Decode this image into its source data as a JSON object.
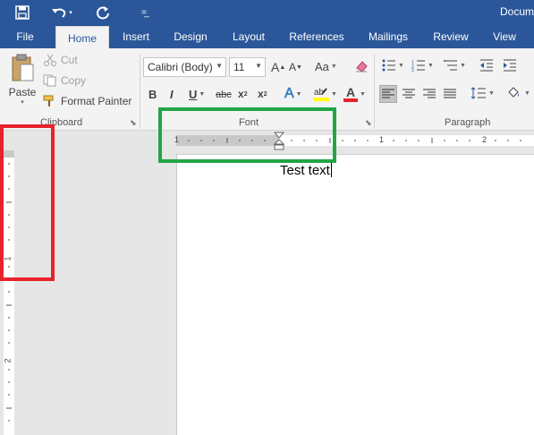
{
  "titlebar": {
    "doc_title": "Docum",
    "icons": [
      "save-icon",
      "undo-icon",
      "redo-icon",
      "customize-qat-icon"
    ]
  },
  "tabs": [
    {
      "label": "File",
      "active": false
    },
    {
      "label": "Home",
      "active": true
    },
    {
      "label": "Insert",
      "active": false
    },
    {
      "label": "Design",
      "active": false
    },
    {
      "label": "Layout",
      "active": false
    },
    {
      "label": "References",
      "active": false
    },
    {
      "label": "Mailings",
      "active": false
    },
    {
      "label": "Review",
      "active": false
    },
    {
      "label": "View",
      "active": false
    }
  ],
  "clipboard": {
    "paste_label": "Paste",
    "cut_label": "Cut",
    "copy_label": "Copy",
    "format_painter_label": "Format Painter",
    "group_label": "Clipboard"
  },
  "font": {
    "font_name": "Calibri (Body)",
    "font_size": "11",
    "grow_label": "A",
    "shrink_label": "A",
    "change_case_label": "Aa",
    "bold": "B",
    "italic": "I",
    "underline": "U",
    "strikethrough": "abc",
    "subscript": "x",
    "superscript": "x",
    "text_effects": "A",
    "font_color": "A",
    "group_label": "Font",
    "highlight_color": "#ffff00",
    "font_color_bar": "#e8222b"
  },
  "paragraph": {
    "group_label": "Paragraph"
  },
  "ruler": {
    "tab_selector": "L",
    "h_numbers": [
      "1",
      "1",
      "2"
    ],
    "v_numbers": [
      "1",
      "2"
    ]
  },
  "document": {
    "text": "Test text"
  },
  "colors": {
    "brand": "#2b579a",
    "red_box": "#e8222b",
    "green_box": "#22a545"
  }
}
